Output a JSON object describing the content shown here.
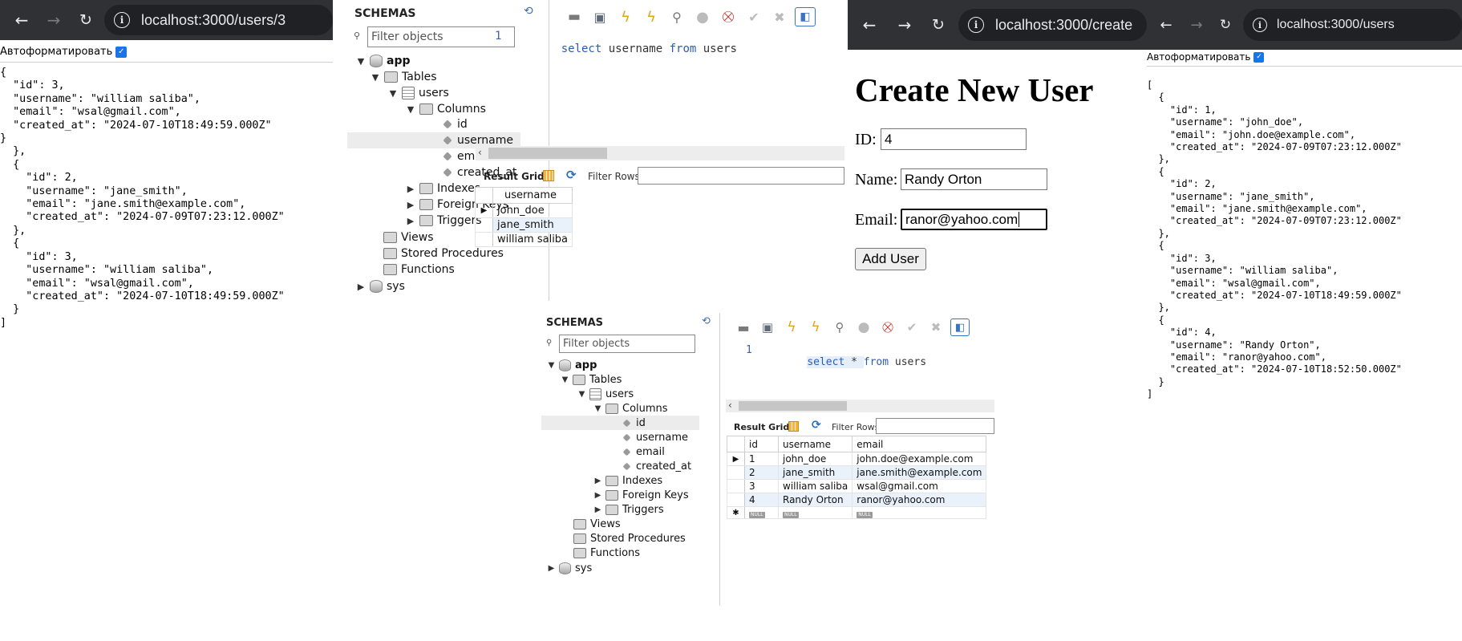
{
  "browser1": {
    "url": "localhost:3000/users/3",
    "autoformat_label": "Автоформатировать",
    "json_text": "{\n  \"id\": 3,\n  \"username\": \"william saliba\",\n  \"email\": \"wsal@gmail.com\",\n  \"created_at\": \"2024-07-10T18:49:59.000Z\"\n}\n  },\n  {\n    \"id\": 2,\n    \"username\": \"jane_smith\",\n    \"email\": \"jane.smith@example.com\",\n    \"created_at\": \"2024-07-09T07:23:12.000Z\"\n  },\n  {\n    \"id\": 3,\n    \"username\": \"william saliba\",\n    \"email\": \"wsal@gmail.com\",\n    \"created_at\": \"2024-07-10T18:49:59.000Z\"\n  }\n]"
  },
  "workbench": {
    "schemas_label": "SCHEMAS",
    "filter_placeholder": "Filter objects",
    "tree": {
      "app": "app",
      "tables": "Tables",
      "users": "users",
      "columns": "Columns",
      "col_id": "id",
      "col_username": "username",
      "col_email": "email",
      "col_created_at": "created_at",
      "indexes": "Indexes",
      "foreign_keys": "Foreign Keys",
      "triggers": "Triggers",
      "views": "Views",
      "stored_procedures": "Stored Procedures",
      "functions": "Functions",
      "sys": "sys"
    },
    "result_grid_label": "Result Grid",
    "filter_rows_label": "Filter Rows:"
  },
  "query1": {
    "line_number": "1",
    "kw_select": "select",
    "middle": " username ",
    "kw_from": "from",
    "tail": " users",
    "header": "username",
    "rows": [
      "john_doe",
      "jane_smith",
      "william saliba"
    ]
  },
  "query2": {
    "line_number": "1",
    "kw_select": "select",
    "middle": " * ",
    "kw_from": "from",
    "tail": " users",
    "headers": [
      "id",
      "username",
      "email"
    ],
    "rows": [
      [
        "1",
        "john_doe",
        "john.doe@example.com"
      ],
      [
        "2",
        "jane_smith",
        "jane.smith@example.com"
      ],
      [
        "3",
        "william saliba",
        "wsal@gmail.com"
      ],
      [
        "4",
        "Randy Orton",
        "ranor@yahoo.com"
      ]
    ],
    "null_label": "NULL"
  },
  "browser2": {
    "url": "localhost:3000/create",
    "title": "Create New User",
    "id_label": "ID:",
    "id_value": "4",
    "name_label": "Name:",
    "name_value": "Randy Orton",
    "email_label": "Email:",
    "email_value": "ranor@yahoo.com",
    "submit_label": "Add User"
  },
  "browser3": {
    "url": "localhost:3000/users",
    "autoformat_label": "Автоформатировать",
    "json_text": "[\n  {\n    \"id\": 1,\n    \"username\": \"john_doe\",\n    \"email\": \"john.doe@example.com\",\n    \"created_at\": \"2024-07-09T07:23:12.000Z\"\n  },\n  {\n    \"id\": 2,\n    \"username\": \"jane_smith\",\n    \"email\": \"jane.smith@example.com\",\n    \"created_at\": \"2024-07-09T07:23:12.000Z\"\n  },\n  {\n    \"id\": 3,\n    \"username\": \"william saliba\",\n    \"email\": \"wsal@gmail.com\",\n    \"created_at\": \"2024-07-10T18:49:59.000Z\"\n  },\n  {\n    \"id\": 4,\n    \"username\": \"Randy Orton\",\n    \"email\": \"ranor@yahoo.com\",\n    \"created_at\": \"2024-07-10T18:52:50.000Z\"\n  }\n]"
  },
  "icons": {
    "back": "back-arrow-icon",
    "forward": "forward-arrow-icon",
    "reload": "reload-icon",
    "site_info": "info-icon",
    "checkbox": "checkmark-icon"
  }
}
